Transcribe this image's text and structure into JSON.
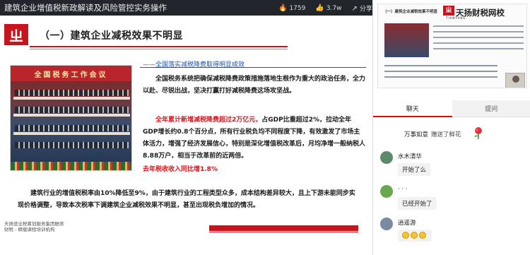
{
  "topbar": {
    "title": "建筑企业增值税新政解读及风险管控实务操作",
    "views_icon": "fire-icon",
    "views": "1759",
    "likes_icon": "thumbs-up-icon",
    "likes": "3.7w",
    "share_icon": "share-icon",
    "share_label": "分享"
  },
  "slide": {
    "logo_glyph": "ㄓ",
    "heading": "（一）建筑企业减税效果不明显",
    "photo_banner": "全国税务工作会议",
    "sub_heading": "——全国落实减税降费取得明显成效",
    "p1": "全国税务系统把确保减税降费政策措施落地生根作为重大的政治任务，全力以赴、尽锐出战，坚决打赢打好减税降费这场攻坚战。",
    "p2_red": "全年累计新增减税降费超过2万亿元，",
    "p2_rest": "占GDP比重超过2%，拉动全年GDP增长约0.8个百分点，所有行业税负均不同程度下降，有效激发了市场主体活力，增强了经济发展信心，特别是深化增值税改革后，月均净增一般纳税人8.88万户，相当于改革前的近两倍。",
    "p3": "去年税收收入同比增1.8%",
    "p4": "建筑行业的增值税税率由10%降低至9%，由于建筑行业的工程类型众多，成本结构差异较大，且上下游未能同步实现价格调整，导致本次税率下调建筑企业减税效果不明显，甚至出现税负增加的情况。",
    "footer_line1": "天扬营业税筹划服务集团联席",
    "footer_line2": "财税 - 精载课程培训机构"
  },
  "preview": {
    "title": "（一）建筑企业减税效果不明显",
    "brand": "天扬财税网校",
    "brand_sub": "TIANYANG"
  },
  "tabs": [
    {
      "label": "聊天",
      "active": true
    },
    {
      "label": "提问",
      "active": false
    }
  ],
  "chat": {
    "gift_text": "万事如意",
    "gift_thanks": "赠送了鲜花",
    "messages": [
      {
        "name": "水木清华",
        "text": "开始了么",
        "avatar_color": "#5c8a6a"
      },
      {
        "name": "·  ·  ·",
        "text": "已经开始了",
        "avatar_color": "#6aa84f"
      },
      {
        "name": "逍遥游",
        "text": "",
        "avatar_color": "#7a8aa0",
        "emojis": 3
      }
    ]
  },
  "colors": {
    "brand_red": "#c8151d",
    "highlight_red": "#d7141c",
    "link_blue": "#1c54a8"
  }
}
